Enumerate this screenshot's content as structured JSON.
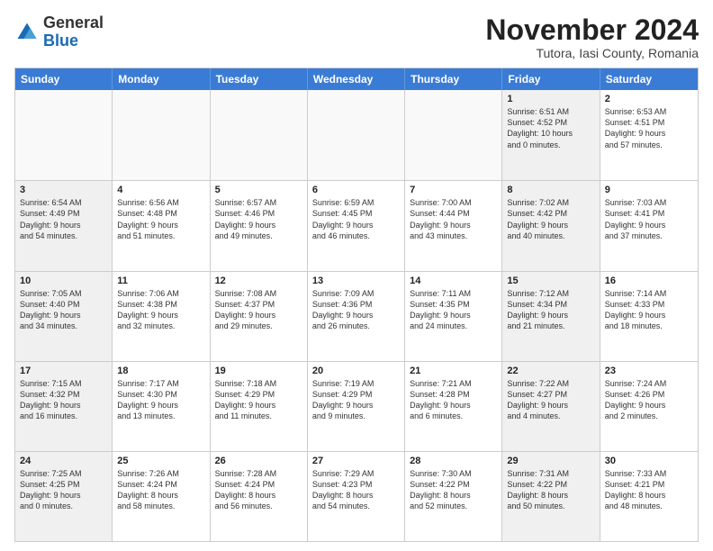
{
  "logo": {
    "general": "General",
    "blue": "Blue"
  },
  "title": "November 2024",
  "subtitle": "Tutora, Iasi County, Romania",
  "header_days": [
    "Sunday",
    "Monday",
    "Tuesday",
    "Wednesday",
    "Thursday",
    "Friday",
    "Saturday"
  ],
  "rows": [
    [
      {
        "day": "",
        "detail": "",
        "empty": true
      },
      {
        "day": "",
        "detail": "",
        "empty": true
      },
      {
        "day": "",
        "detail": "",
        "empty": true
      },
      {
        "day": "",
        "detail": "",
        "empty": true
      },
      {
        "day": "",
        "detail": "",
        "empty": true
      },
      {
        "day": "1",
        "detail": "Sunrise: 6:51 AM\nSunset: 4:52 PM\nDaylight: 10 hours\nand 0 minutes.",
        "shaded": true
      },
      {
        "day": "2",
        "detail": "Sunrise: 6:53 AM\nSunset: 4:51 PM\nDaylight: 9 hours\nand 57 minutes.",
        "shaded": false
      }
    ],
    [
      {
        "day": "3",
        "detail": "Sunrise: 6:54 AM\nSunset: 4:49 PM\nDaylight: 9 hours\nand 54 minutes.",
        "shaded": true
      },
      {
        "day": "4",
        "detail": "Sunrise: 6:56 AM\nSunset: 4:48 PM\nDaylight: 9 hours\nand 51 minutes.",
        "shaded": false
      },
      {
        "day": "5",
        "detail": "Sunrise: 6:57 AM\nSunset: 4:46 PM\nDaylight: 9 hours\nand 49 minutes.",
        "shaded": false
      },
      {
        "day": "6",
        "detail": "Sunrise: 6:59 AM\nSunset: 4:45 PM\nDaylight: 9 hours\nand 46 minutes.",
        "shaded": false
      },
      {
        "day": "7",
        "detail": "Sunrise: 7:00 AM\nSunset: 4:44 PM\nDaylight: 9 hours\nand 43 minutes.",
        "shaded": false
      },
      {
        "day": "8",
        "detail": "Sunrise: 7:02 AM\nSunset: 4:42 PM\nDaylight: 9 hours\nand 40 minutes.",
        "shaded": true
      },
      {
        "day": "9",
        "detail": "Sunrise: 7:03 AM\nSunset: 4:41 PM\nDaylight: 9 hours\nand 37 minutes.",
        "shaded": false
      }
    ],
    [
      {
        "day": "10",
        "detail": "Sunrise: 7:05 AM\nSunset: 4:40 PM\nDaylight: 9 hours\nand 34 minutes.",
        "shaded": true
      },
      {
        "day": "11",
        "detail": "Sunrise: 7:06 AM\nSunset: 4:38 PM\nDaylight: 9 hours\nand 32 minutes.",
        "shaded": false
      },
      {
        "day": "12",
        "detail": "Sunrise: 7:08 AM\nSunset: 4:37 PM\nDaylight: 9 hours\nand 29 minutes.",
        "shaded": false
      },
      {
        "day": "13",
        "detail": "Sunrise: 7:09 AM\nSunset: 4:36 PM\nDaylight: 9 hours\nand 26 minutes.",
        "shaded": false
      },
      {
        "day": "14",
        "detail": "Sunrise: 7:11 AM\nSunset: 4:35 PM\nDaylight: 9 hours\nand 24 minutes.",
        "shaded": false
      },
      {
        "day": "15",
        "detail": "Sunrise: 7:12 AM\nSunset: 4:34 PM\nDaylight: 9 hours\nand 21 minutes.",
        "shaded": true
      },
      {
        "day": "16",
        "detail": "Sunrise: 7:14 AM\nSunset: 4:33 PM\nDaylight: 9 hours\nand 18 minutes.",
        "shaded": false
      }
    ],
    [
      {
        "day": "17",
        "detail": "Sunrise: 7:15 AM\nSunset: 4:32 PM\nDaylight: 9 hours\nand 16 minutes.",
        "shaded": true
      },
      {
        "day": "18",
        "detail": "Sunrise: 7:17 AM\nSunset: 4:30 PM\nDaylight: 9 hours\nand 13 minutes.",
        "shaded": false
      },
      {
        "day": "19",
        "detail": "Sunrise: 7:18 AM\nSunset: 4:29 PM\nDaylight: 9 hours\nand 11 minutes.",
        "shaded": false
      },
      {
        "day": "20",
        "detail": "Sunrise: 7:19 AM\nSunset: 4:29 PM\nDaylight: 9 hours\nand 9 minutes.",
        "shaded": false
      },
      {
        "day": "21",
        "detail": "Sunrise: 7:21 AM\nSunset: 4:28 PM\nDaylight: 9 hours\nand 6 minutes.",
        "shaded": false
      },
      {
        "day": "22",
        "detail": "Sunrise: 7:22 AM\nSunset: 4:27 PM\nDaylight: 9 hours\nand 4 minutes.",
        "shaded": true
      },
      {
        "day": "23",
        "detail": "Sunrise: 7:24 AM\nSunset: 4:26 PM\nDaylight: 9 hours\nand 2 minutes.",
        "shaded": false
      }
    ],
    [
      {
        "day": "24",
        "detail": "Sunrise: 7:25 AM\nSunset: 4:25 PM\nDaylight: 9 hours\nand 0 minutes.",
        "shaded": true
      },
      {
        "day": "25",
        "detail": "Sunrise: 7:26 AM\nSunset: 4:24 PM\nDaylight: 8 hours\nand 58 minutes.",
        "shaded": false
      },
      {
        "day": "26",
        "detail": "Sunrise: 7:28 AM\nSunset: 4:24 PM\nDaylight: 8 hours\nand 56 minutes.",
        "shaded": false
      },
      {
        "day": "27",
        "detail": "Sunrise: 7:29 AM\nSunset: 4:23 PM\nDaylight: 8 hours\nand 54 minutes.",
        "shaded": false
      },
      {
        "day": "28",
        "detail": "Sunrise: 7:30 AM\nSunset: 4:22 PM\nDaylight: 8 hours\nand 52 minutes.",
        "shaded": false
      },
      {
        "day": "29",
        "detail": "Sunrise: 7:31 AM\nSunset: 4:22 PM\nDaylight: 8 hours\nand 50 minutes.",
        "shaded": true
      },
      {
        "day": "30",
        "detail": "Sunrise: 7:33 AM\nSunset: 4:21 PM\nDaylight: 8 hours\nand 48 minutes.",
        "shaded": false
      }
    ]
  ]
}
